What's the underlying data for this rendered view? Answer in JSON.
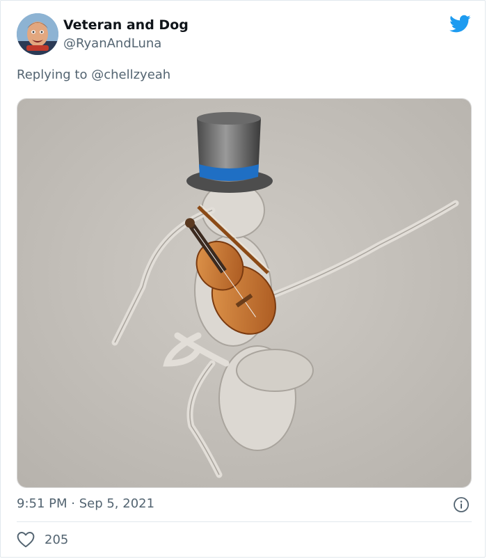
{
  "tweet": {
    "display_name": "Veteran and Dog",
    "handle": "@RyanAndLuna",
    "reply_prefix": "Replying to",
    "reply_to": "@chellzyeah",
    "timestamp": "9:51 PM · Sep 5, 2021",
    "likes": "205"
  },
  "icons": {
    "platform": "twitter-bird-icon",
    "info": "info-icon",
    "like": "heart-icon"
  },
  "colors": {
    "brand": "#1d9bf0",
    "secondary_text": "#536471",
    "divider": "#e1e8ed"
  }
}
